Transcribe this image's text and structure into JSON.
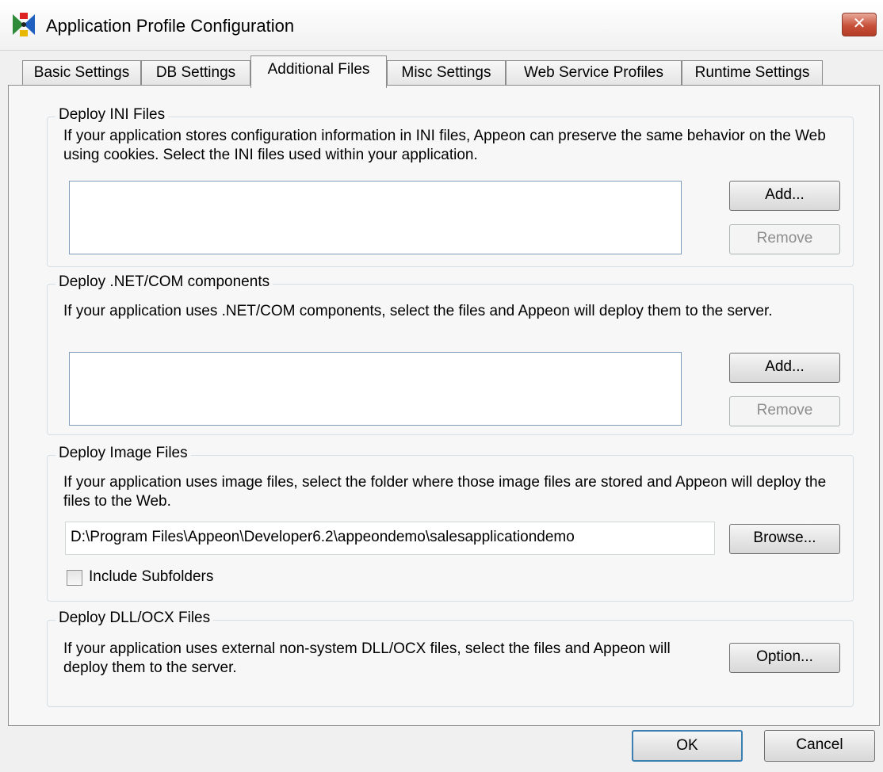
{
  "window": {
    "title": "Application Profile Configuration",
    "close_label": "✕"
  },
  "tabs": [
    {
      "label": "Basic Settings"
    },
    {
      "label": "DB Settings"
    },
    {
      "label": "Additional Files"
    },
    {
      "label": "Misc Settings"
    },
    {
      "label": "Web Service Profiles"
    },
    {
      "label": "Runtime Settings"
    }
  ],
  "active_tab": "Additional Files",
  "ini_files": {
    "title": "Deploy INI Files",
    "description": "If your application stores configuration information in INI files, Appeon can preserve the same behavior on the Web using cookies.  Select the INI files used within your application.",
    "add_label": "Add...",
    "remove_label": "Remove"
  },
  "net_com": {
    "title": "Deploy .NET/COM components",
    "description": "If your application uses .NET/COM components, select the files and Appeon will deploy them to the server.",
    "add_label": "Add...",
    "remove_label": "Remove"
  },
  "image_files": {
    "title": "Deploy Image Files",
    "description": "If your application uses image files, select the folder where those image files are stored and Appeon will deploy the files to the Web.",
    "path_value": "D:\\Program Files\\Appeon\\Developer6.2\\appeondemo\\salesapplicationdemo",
    "browse_label": "Browse...",
    "include_subfolders_label": "Include Subfolders",
    "include_subfolders_checked": false
  },
  "dll_ocx": {
    "title": "Deploy DLL/OCX Files",
    "description": "If your application uses external non-system DLL/OCX files, select the files and Appeon will deploy them to the server.",
    "option_label": "Option..."
  },
  "footer": {
    "ok_label": "OK",
    "cancel_label": "Cancel"
  }
}
